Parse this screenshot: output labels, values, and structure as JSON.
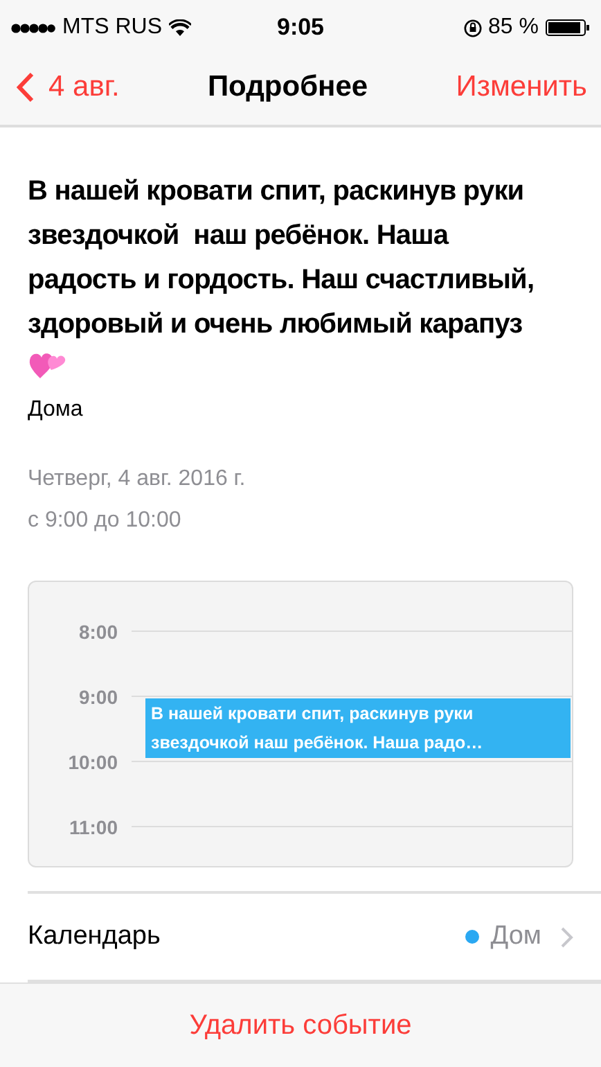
{
  "status_bar": {
    "carrier": "MTS RUS",
    "time": "9:05",
    "battery": "85 %"
  },
  "nav": {
    "back": "4 авг.",
    "title": "Подробнее",
    "action": "Изменить"
  },
  "event": {
    "title": "В нашей кровати спит, раскинув руки звездочкой  наш ребёнок. Наша радость и гордость. Наш счастливый, здоровый и очень любимый карапуз",
    "location": "Дома",
    "date": "Четверг, 4 авг. 2016 г.",
    "time": "с 9:00 до 10:00"
  },
  "day_view": {
    "hours": [
      "8:00",
      "9:00",
      "10:00",
      "11:00"
    ],
    "event_text": "В нашей кровати спит, раскинув руки звездочкой  наш ребёнок. Наша радо…"
  },
  "calendar_row": {
    "label": "Календарь",
    "value": "Дом",
    "color": "#2aa8f2"
  },
  "delete_button": "Удалить событие"
}
